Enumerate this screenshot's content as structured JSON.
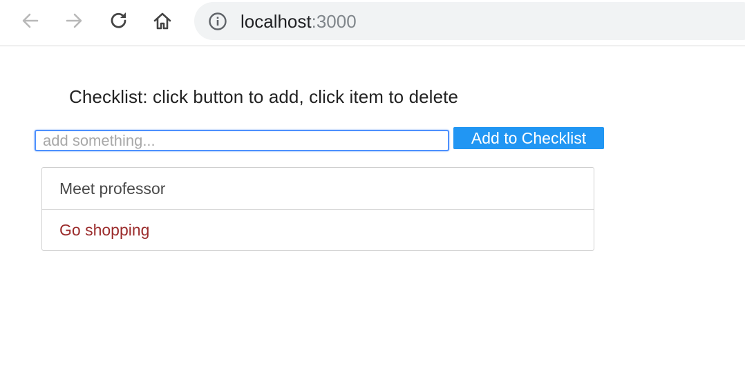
{
  "browser": {
    "back_icon": "arrow-left-icon",
    "forward_icon": "arrow-right-icon",
    "reload_icon": "reload-icon",
    "home_icon": "home-icon",
    "info_icon": "info-icon",
    "url_host": "localhost",
    "url_port": ":3000"
  },
  "page": {
    "heading": "Checklist: click button to add, click item to delete",
    "input_placeholder": "add something...",
    "input_value": "",
    "add_button_label": "Add to Checklist",
    "items": [
      {
        "label": "Meet professor",
        "color": "#4a4a4a"
      },
      {
        "label": "Go shopping",
        "color": "#9b2c2c"
      }
    ]
  },
  "colors": {
    "button_bg": "#2196f3",
    "input_focus_border": "#4d90fe",
    "omnibox_bg": "#f1f3f4"
  }
}
